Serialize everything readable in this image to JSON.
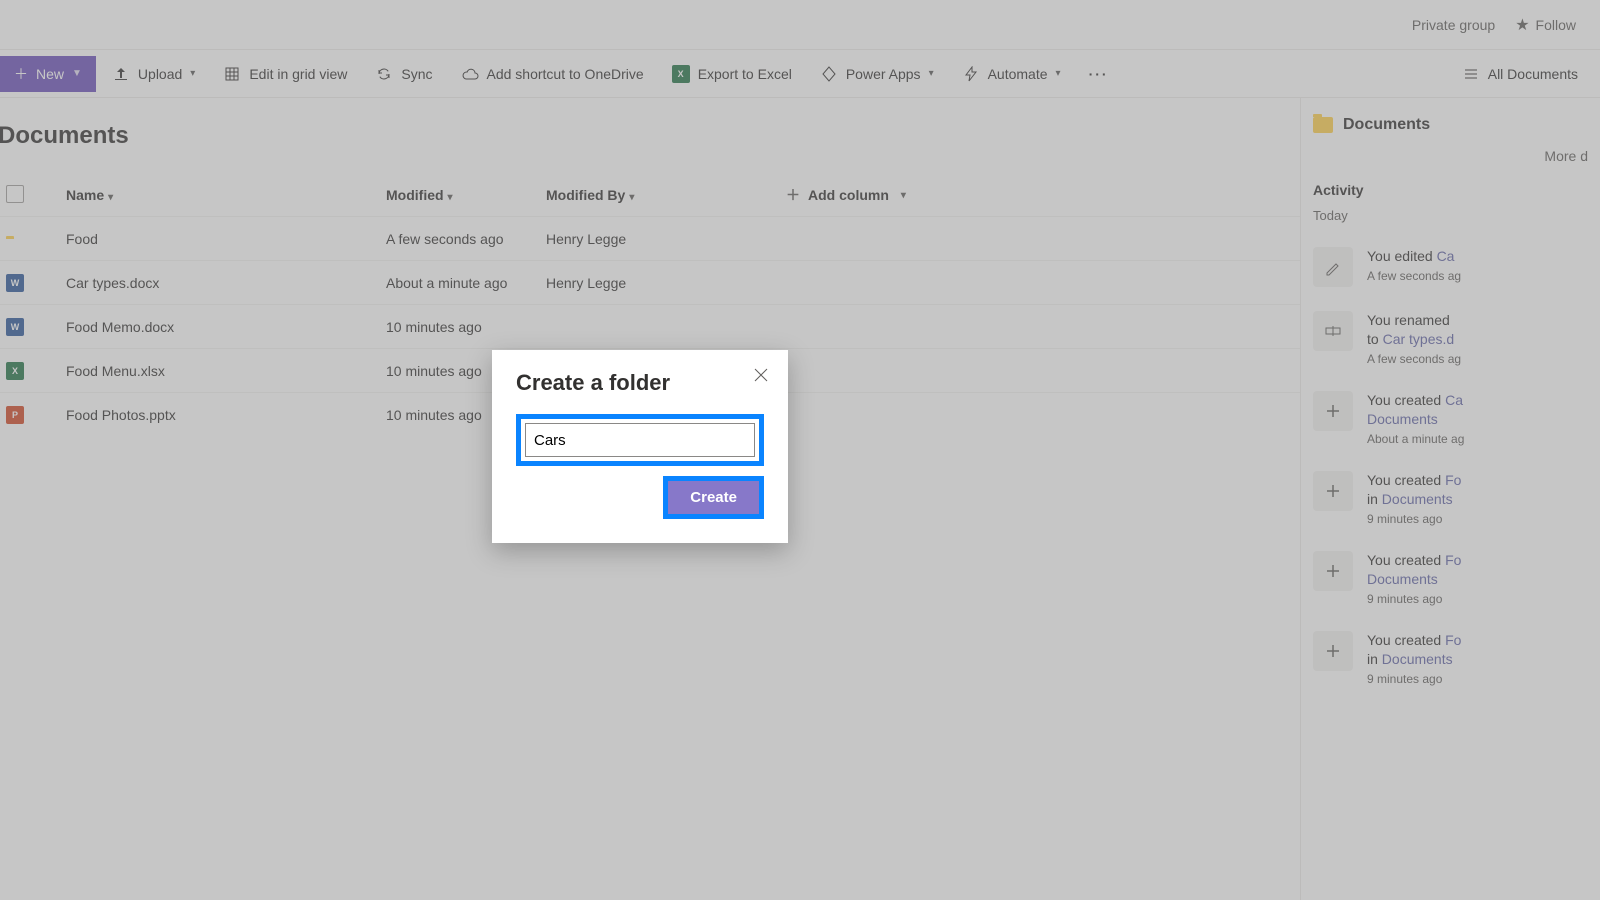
{
  "topbar": {
    "privacy": "Private group",
    "follow": "Follow"
  },
  "commands": {
    "new": "New",
    "upload": "Upload",
    "editgrid": "Edit in grid view",
    "sync": "Sync",
    "shortcut": "Add shortcut to OneDrive",
    "export": "Export to Excel",
    "powerapps": "Power Apps",
    "automate": "Automate",
    "viewname": "All Documents"
  },
  "page": {
    "title": "Documents"
  },
  "columns": {
    "name": "Name",
    "modified": "Modified",
    "modifiedby": "Modified By",
    "addcolumn": "Add column"
  },
  "rows": [
    {
      "icon": "folder",
      "name": "Food",
      "modified": "A few seconds ago",
      "by": "Henry Legge"
    },
    {
      "icon": "docx",
      "name": "Car types.docx",
      "modified": "About a minute ago",
      "by": "Henry Legge"
    },
    {
      "icon": "docx",
      "name": "Food Memo.docx",
      "modified": "10 minutes ago",
      "by": ""
    },
    {
      "icon": "xlsx",
      "name": "Food Menu.xlsx",
      "modified": "10 minutes ago",
      "by": ""
    },
    {
      "icon": "pptx",
      "name": "Food Photos.pptx",
      "modified": "10 minutes ago",
      "by": ""
    }
  ],
  "sidepanel": {
    "title": "Documents",
    "more": "More d",
    "activity_hdr": "Activity",
    "today": "Today",
    "items": [
      {
        "icon": "edit",
        "line1a": "You edited ",
        "link1": "Ca",
        "line2": "",
        "time": "A few seconds ag"
      },
      {
        "icon": "rename",
        "line1a": "You renamed ",
        "link1": "",
        "line2_pre": "to ",
        "link2": "Car types.d",
        "time": "A few seconds ag"
      },
      {
        "icon": "add",
        "line1a": "You created ",
        "link1": "Ca",
        "line2_pre": "",
        "link2": "Documents",
        "time": "About a minute ag"
      },
      {
        "icon": "add",
        "line1a": "You created ",
        "link1": "Fo",
        "line2_pre": "in ",
        "link2": "Documents",
        "time": "9 minutes ago"
      },
      {
        "icon": "add",
        "line1a": "You created ",
        "link1": "Fo",
        "line2_pre": "",
        "link2": "Documents",
        "time": "9 minutes ago"
      },
      {
        "icon": "add",
        "line1a": "You created ",
        "link1": "Fo",
        "line2_pre": "in ",
        "link2": "Documents",
        "time": "9 minutes ago"
      }
    ]
  },
  "dialog": {
    "title": "Create a folder",
    "input_value": "Cars",
    "create": "Create"
  }
}
